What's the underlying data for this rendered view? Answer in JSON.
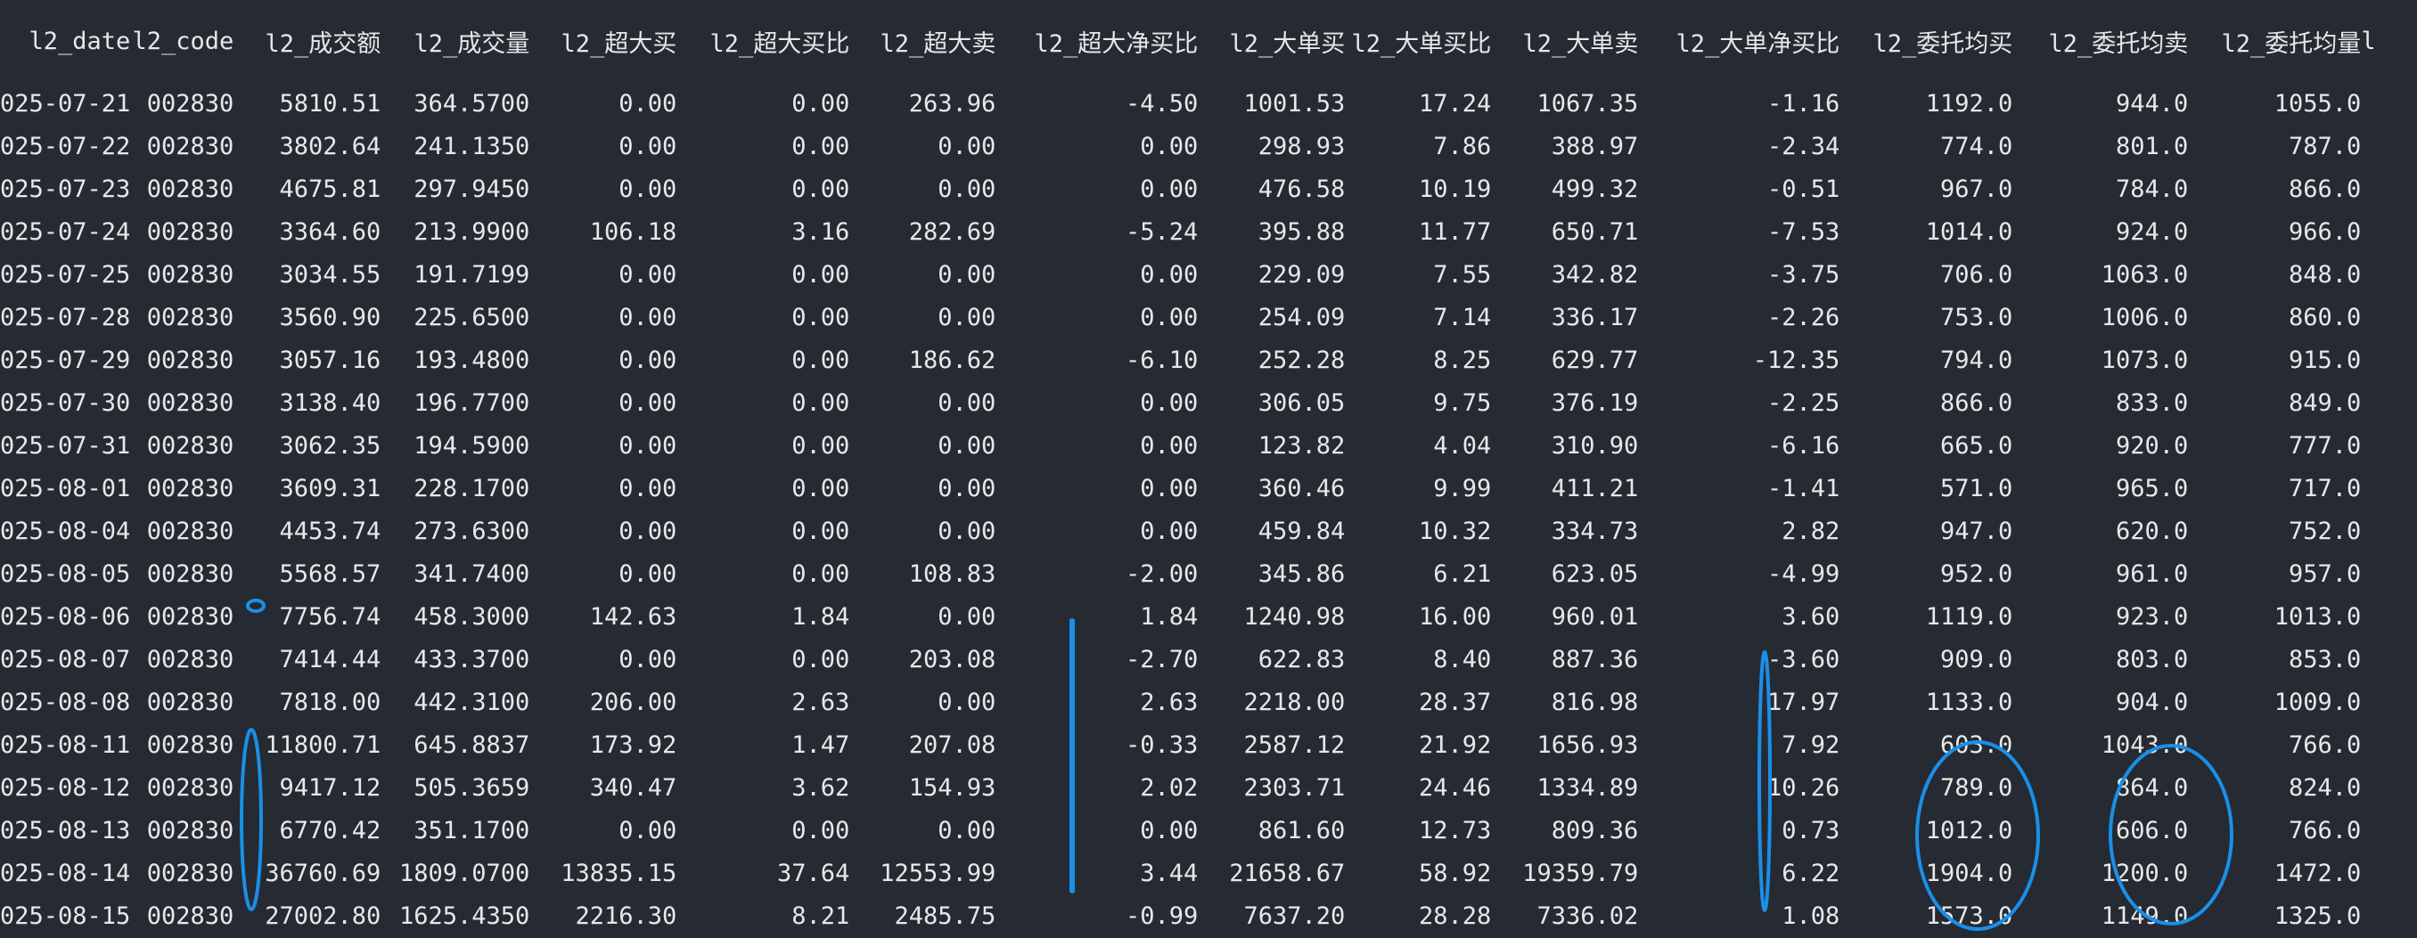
{
  "table": {
    "headers": [
      "l2_date",
      "l2_code",
      "l2_成交额",
      "l2_成交量",
      "l2_超大买",
      "l2_超大买比",
      "l2_超大卖",
      "l2_超大净买比",
      "l2_大单买",
      "l2_大单买比",
      "l2_大单卖",
      "l2_大单净买比",
      "l2_委托均买",
      "l2_委托均卖",
      "l2_委托均量",
      "l"
    ],
    "rows": [
      [
        "025-07-21",
        "002830",
        "5810.51",
        "364.5700",
        "0.00",
        "0.00",
        "263.96",
        "-4.50",
        "1001.53",
        "17.24",
        "1067.35",
        "-1.16",
        "1192.0",
        "944.0",
        "1055.0"
      ],
      [
        "025-07-22",
        "002830",
        "3802.64",
        "241.1350",
        "0.00",
        "0.00",
        "0.00",
        "0.00",
        "298.93",
        "7.86",
        "388.97",
        "-2.34",
        "774.0",
        "801.0",
        "787.0"
      ],
      [
        "025-07-23",
        "002830",
        "4675.81",
        "297.9450",
        "0.00",
        "0.00",
        "0.00",
        "0.00",
        "476.58",
        "10.19",
        "499.32",
        "-0.51",
        "967.0",
        "784.0",
        "866.0"
      ],
      [
        "025-07-24",
        "002830",
        "3364.60",
        "213.9900",
        "106.18",
        "3.16",
        "282.69",
        "-5.24",
        "395.88",
        "11.77",
        "650.71",
        "-7.53",
        "1014.0",
        "924.0",
        "966.0"
      ],
      [
        "025-07-25",
        "002830",
        "3034.55",
        "191.7199",
        "0.00",
        "0.00",
        "0.00",
        "0.00",
        "229.09",
        "7.55",
        "342.82",
        "-3.75",
        "706.0",
        "1063.0",
        "848.0"
      ],
      [
        "025-07-28",
        "002830",
        "3560.90",
        "225.6500",
        "0.00",
        "0.00",
        "0.00",
        "0.00",
        "254.09",
        "7.14",
        "336.17",
        "-2.26",
        "753.0",
        "1006.0",
        "860.0"
      ],
      [
        "025-07-29",
        "002830",
        "3057.16",
        "193.4800",
        "0.00",
        "0.00",
        "186.62",
        "-6.10",
        "252.28",
        "8.25",
        "629.77",
        "-12.35",
        "794.0",
        "1073.0",
        "915.0"
      ],
      [
        "025-07-30",
        "002830",
        "3138.40",
        "196.7700",
        "0.00",
        "0.00",
        "0.00",
        "0.00",
        "306.05",
        "9.75",
        "376.19",
        "-2.25",
        "866.0",
        "833.0",
        "849.0"
      ],
      [
        "025-07-31",
        "002830",
        "3062.35",
        "194.5900",
        "0.00",
        "0.00",
        "0.00",
        "0.00",
        "123.82",
        "4.04",
        "310.90",
        "-6.16",
        "665.0",
        "920.0",
        "777.0"
      ],
      [
        "025-08-01",
        "002830",
        "3609.31",
        "228.1700",
        "0.00",
        "0.00",
        "0.00",
        "0.00",
        "360.46",
        "9.99",
        "411.21",
        "-1.41",
        "571.0",
        "965.0",
        "717.0"
      ],
      [
        "025-08-04",
        "002830",
        "4453.74",
        "273.6300",
        "0.00",
        "0.00",
        "0.00",
        "0.00",
        "459.84",
        "10.32",
        "334.73",
        "2.82",
        "947.0",
        "620.0",
        "752.0"
      ],
      [
        "025-08-05",
        "002830",
        "5568.57",
        "341.7400",
        "0.00",
        "0.00",
        "108.83",
        "-2.00",
        "345.86",
        "6.21",
        "623.05",
        "-4.99",
        "952.0",
        "961.0",
        "957.0"
      ],
      [
        "025-08-06",
        "002830",
        "7756.74",
        "458.3000",
        "142.63",
        "1.84",
        "0.00",
        "1.84",
        "1240.98",
        "16.00",
        "960.01",
        "3.60",
        "1119.0",
        "923.0",
        "1013.0"
      ],
      [
        "025-08-07",
        "002830",
        "7414.44",
        "433.3700",
        "0.00",
        "0.00",
        "203.08",
        "-2.70",
        "622.83",
        "8.40",
        "887.36",
        "-3.60",
        "909.0",
        "803.0",
        "853.0"
      ],
      [
        "025-08-08",
        "002830",
        "7818.00",
        "442.3100",
        "206.00",
        "2.63",
        "0.00",
        "2.63",
        "2218.00",
        "28.37",
        "816.98",
        "17.97",
        "1133.0",
        "904.0",
        "1009.0"
      ],
      [
        "025-08-11",
        "002830",
        "11800.71",
        "645.8837",
        "173.92",
        "1.47",
        "207.08",
        "-0.33",
        "2587.12",
        "21.92",
        "1656.93",
        "7.92",
        "603.0",
        "1043.0",
        "766.0"
      ],
      [
        "025-08-12",
        "002830",
        "9417.12",
        "505.3659",
        "340.47",
        "3.62",
        "154.93",
        "2.02",
        "2303.71",
        "24.46",
        "1334.89",
        "10.26",
        "789.0",
        "864.0",
        "824.0"
      ],
      [
        "025-08-13",
        "002830",
        "6770.42",
        "351.1700",
        "0.00",
        "0.00",
        "0.00",
        "0.00",
        "861.60",
        "12.73",
        "809.36",
        "0.73",
        "1012.0",
        "606.0",
        "766.0"
      ],
      [
        "025-08-14",
        "002830",
        "36760.69",
        "1809.0700",
        "13835.15",
        "37.64",
        "12553.99",
        "3.44",
        "21658.67",
        "58.92",
        "19359.79",
        "6.22",
        "1904.0",
        "1200.0",
        "1472.0"
      ],
      [
        "025-08-15",
        "002830",
        "27002.80",
        "1625.4350",
        "2216.30",
        "8.21",
        "2485.75",
        "-0.99",
        "7637.20",
        "28.28",
        "7336.02",
        "1.08",
        "1573.0",
        "1149.0",
        "1325.0"
      ]
    ]
  },
  "colors": {
    "background": "#262a33",
    "text": "#e8e8e8",
    "annotation": "#1a8fe8"
  }
}
